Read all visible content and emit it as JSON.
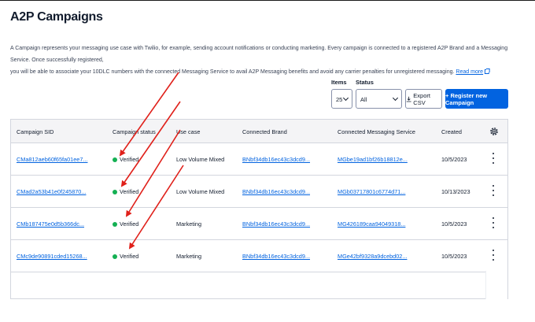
{
  "page": {
    "title": "A2P Campaigns",
    "description_line1": "A Campaign represents your messaging use case with Twilio, for example, sending account notifications or conducting marketing. Every campaign is connected to a registered A2P Brand and a Messaging Service. Once successfully registered,",
    "description_line2": "you will be able to associate your 10DLC numbers with the connected Messaging Service to avail A2P Messaging benefits and avoid any carrier penalties for unregistered messaging.",
    "read_more": "Read more"
  },
  "controls": {
    "items_label": "Items",
    "items_value": "25",
    "status_label": "Status",
    "status_value": "All",
    "export_label": "Export CSV",
    "register_label": "+ Register new Campaign"
  },
  "table": {
    "headers": [
      "Campaign SID",
      "Campaign status",
      "Use case",
      "Connected Brand",
      "Connected Messaging Service",
      "Created"
    ],
    "rows": [
      {
        "sid": "CMa812aeb60f65fa01ee7...",
        "status": "Verified",
        "use_case": "Low Volume Mixed",
        "brand": "BNbf34db16ec43c3dcd9...",
        "service": "MGbe19ad1bf26b18812e...",
        "created": "10/5/2023"
      },
      {
        "sid": "CMad2a53b41e0f245870...",
        "status": "Verified",
        "use_case": "Low Volume Mixed",
        "brand": "BNbf34db16ec43c3dcd9...",
        "service": "MGb03717801c6774d71...",
        "created": "10/13/2023"
      },
      {
        "sid": "CMb187475e0d5b366dc...",
        "status": "Verified",
        "use_case": "Marketing",
        "brand": "BNbf34db16ec43c3dcd9...",
        "service": "MG426189caa94049318...",
        "created": "10/5/2023"
      },
      {
        "sid": "CMc9de90891cded15268...",
        "status": "Verified",
        "use_case": "Marketing",
        "brand": "BNbf34db16ec43c3dcd9...",
        "service": "MGe42bf9328a9dcebd02...",
        "created": "10/5/2023"
      }
    ]
  },
  "annotations": {
    "arrow_color": "#e0201a"
  },
  "colors": {
    "accent": "#0263e0",
    "verified": "#14b053"
  }
}
